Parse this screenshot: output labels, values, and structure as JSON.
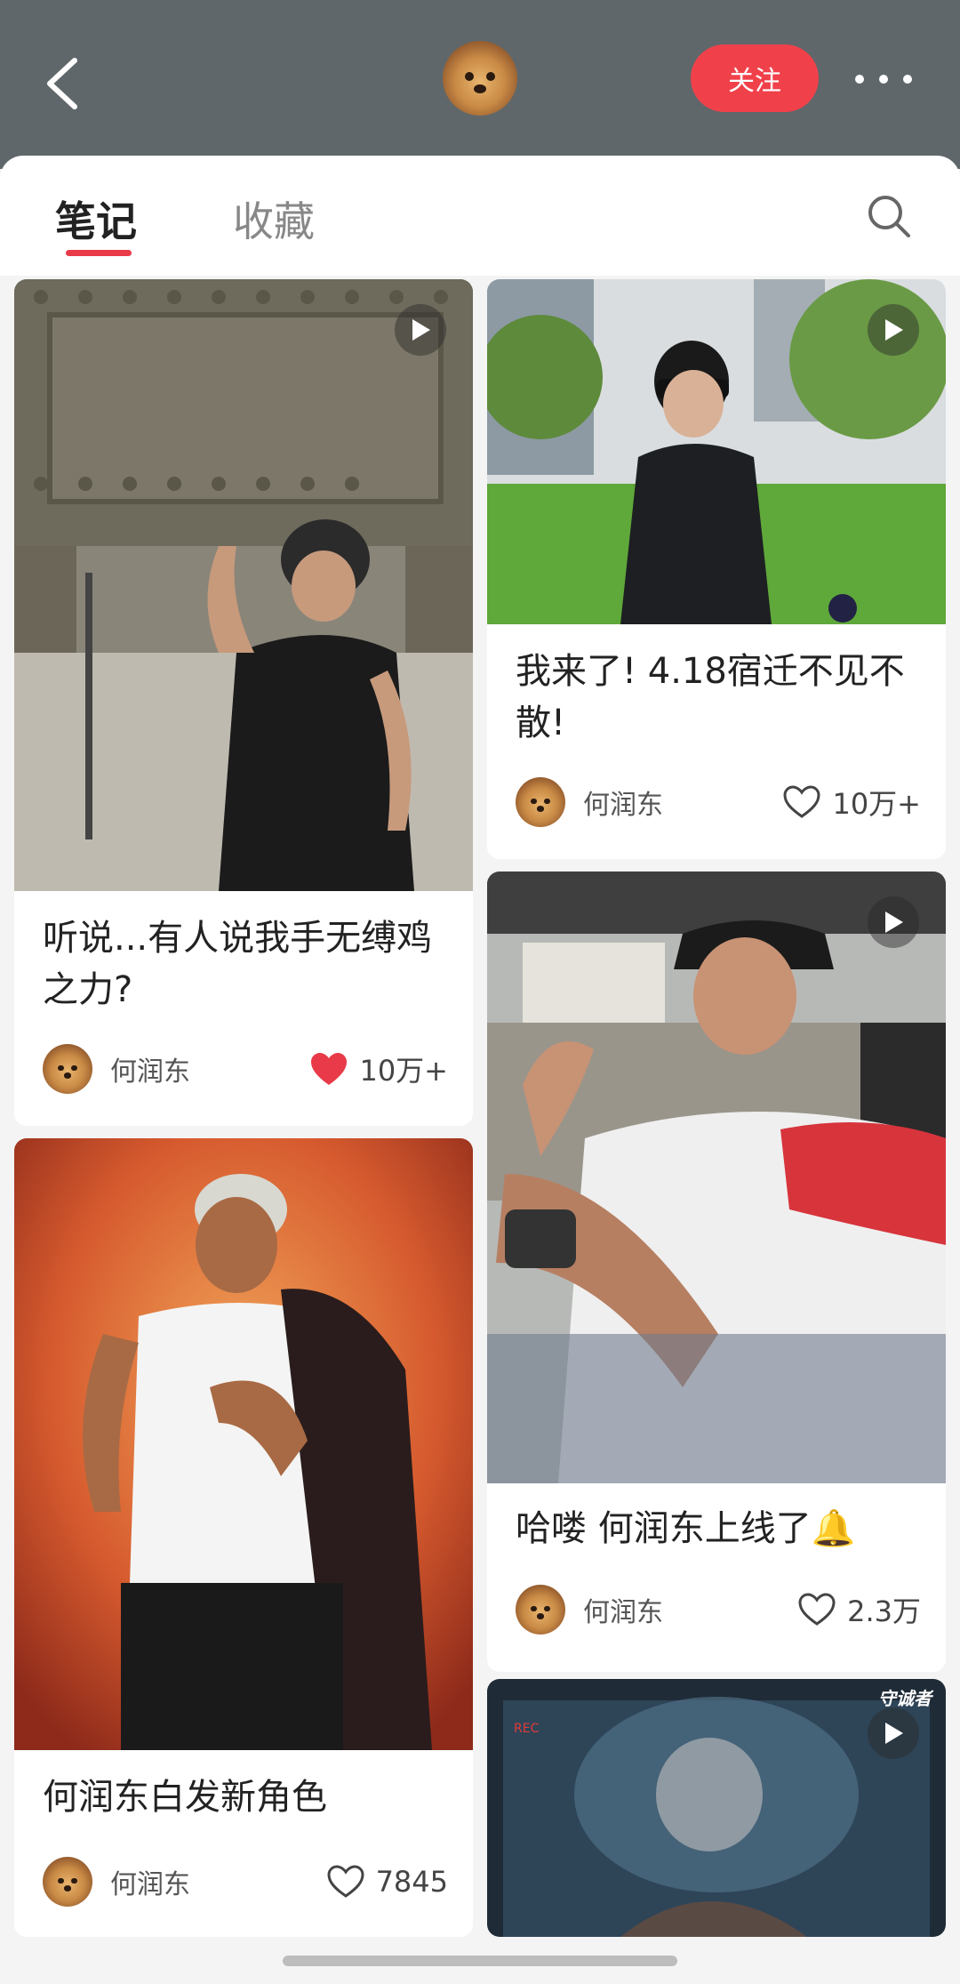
{
  "header": {
    "follow_label": "关注",
    "icons": [
      "back-arrow-icon",
      "dog-avatar",
      "more-dots-icon"
    ]
  },
  "tabs": {
    "notes": "笔记",
    "favorites": "收藏",
    "active": "笔记",
    "search_icon": "search-icon"
  },
  "colors": {
    "accent": "#f0414b",
    "header_bg": "#5f676b",
    "liked_heart": "#e83a48"
  },
  "posts": [
    {
      "title": "听说...有人说我手无缚鸡之力?",
      "author": "何润东",
      "likes": "10万+",
      "liked": true,
      "video": true
    },
    {
      "title": "我来了! 4.18宿迁不见不散!",
      "author": "何润东",
      "likes": "10万+",
      "liked": false,
      "video": true
    },
    {
      "title": "何润东白发新角色",
      "author": "何润东",
      "likes": "7845",
      "liked": false,
      "video": false
    },
    {
      "title": "哈喽 何润东上线了🔔",
      "author": "何润东",
      "likes": "2.3万",
      "liked": false,
      "video": true
    },
    {
      "overlay_text": "守诚者",
      "rec_label": "REC",
      "video": true
    }
  ]
}
